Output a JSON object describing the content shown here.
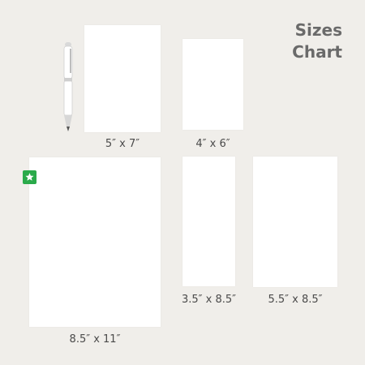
{
  "title": {
    "line1": "Sizes",
    "line2": "Chart"
  },
  "sizes": [
    {
      "label": "5″ x 7″"
    },
    {
      "label": "4″ x 6″"
    },
    {
      "label": "8.5″ x 11″",
      "badge_icon": "star-icon"
    },
    {
      "label": "3.5″ x 8.5″"
    },
    {
      "label": "5.5″ x 8.5″"
    }
  ],
  "colors": {
    "background": "#f0eeea",
    "paper": "#ffffff",
    "title": "#6a6a6a",
    "label": "#4a4a4a",
    "badge": "#2aaa4a"
  },
  "decor": {
    "pen_icon": "pen-icon"
  }
}
